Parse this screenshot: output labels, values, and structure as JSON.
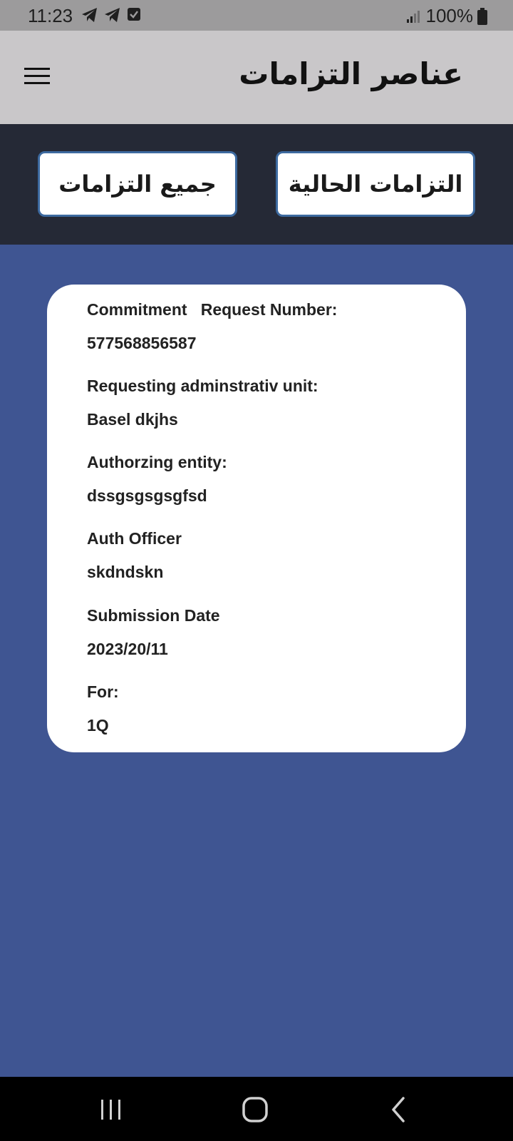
{
  "status_bar": {
    "time": "11:23",
    "battery": "100%",
    "left_icons": [
      "telegram-icon",
      "telegram-icon",
      "checkbox-notification-icon"
    ],
    "right_icons": [
      "signal-icon",
      "battery-icon"
    ]
  },
  "app_bar": {
    "title": "عناصر التزامات",
    "menu_icon": "hamburger-menu-icon"
  },
  "tabs": {
    "all_label": "جميع التزامات",
    "current_label": "التزامات الحالية"
  },
  "card": {
    "request_number_label": "Commitment   Request Number:",
    "request_number_value": "577568856587",
    "unit_label": "Requesting adminstrativ unit:",
    "unit_value": "Basel dkjhs",
    "entity_label": "Authorzing entity:",
    "entity_value": "dssgsgsgsgfsd",
    "officer_label": "Auth Officer",
    "officer_value": "skdndskn",
    "date_label": "Submission Date",
    "date_value": "2023/20/11",
    "for_label": "For:",
    "for_value": "1Q"
  },
  "nav_bar": {
    "icons": [
      "recent-apps-icon",
      "home-icon",
      "back-icon"
    ]
  },
  "colors": {
    "background": "#3f5592",
    "app_bar": "#c9c7c9",
    "tab_bar": "#252936",
    "tab_border": "#3d6aa0",
    "card": "#ffffff"
  }
}
